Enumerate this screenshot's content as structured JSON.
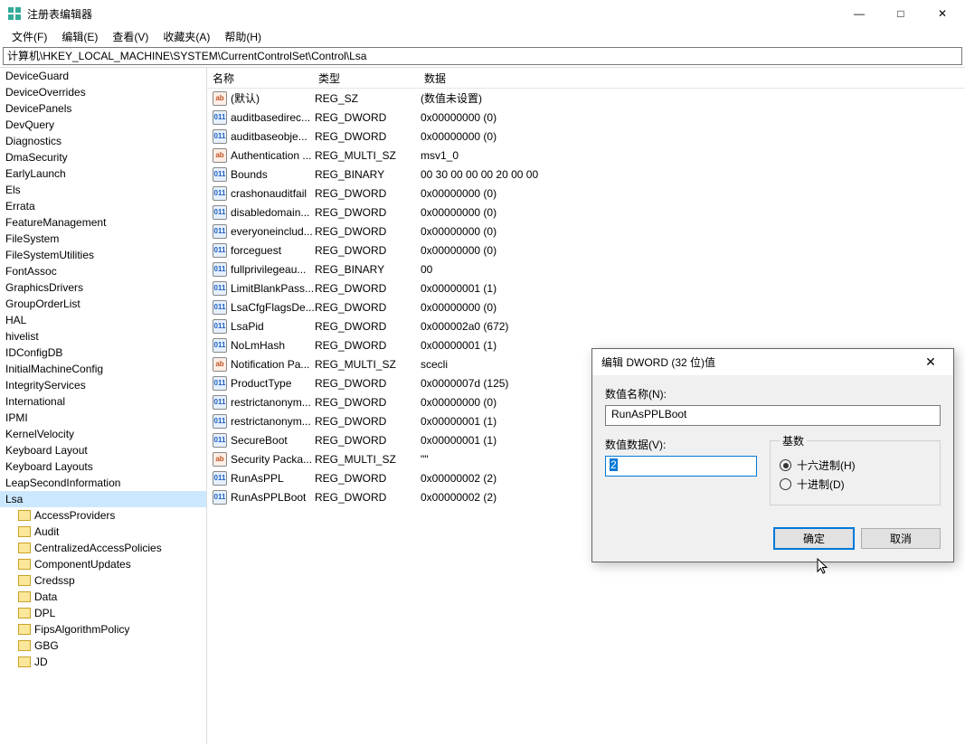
{
  "window": {
    "title": "注册表编辑器",
    "minimize": "—",
    "maximize": "□",
    "close": "✕"
  },
  "menu": {
    "file": "文件(F)",
    "edit": "编辑(E)",
    "view": "查看(V)",
    "favorites": "收藏夹(A)",
    "help": "帮助(H)"
  },
  "address": "计算机\\HKEY_LOCAL_MACHINE\\SYSTEM\\CurrentControlSet\\Control\\Lsa",
  "tree": {
    "items": [
      {
        "label": "DeviceGuard",
        "indent": 0,
        "icon": false
      },
      {
        "label": "DeviceOverrides",
        "indent": 0,
        "icon": false
      },
      {
        "label": "DevicePanels",
        "indent": 0,
        "icon": false
      },
      {
        "label": "DevQuery",
        "indent": 0,
        "icon": false
      },
      {
        "label": "Diagnostics",
        "indent": 0,
        "icon": false
      },
      {
        "label": "DmaSecurity",
        "indent": 0,
        "icon": false
      },
      {
        "label": "EarlyLaunch",
        "indent": 0,
        "icon": false
      },
      {
        "label": "Els",
        "indent": 0,
        "icon": false
      },
      {
        "label": "Errata",
        "indent": 0,
        "icon": false
      },
      {
        "label": "FeatureManagement",
        "indent": 0,
        "icon": false
      },
      {
        "label": "FileSystem",
        "indent": 0,
        "icon": false
      },
      {
        "label": "FileSystemUtilities",
        "indent": 0,
        "icon": false
      },
      {
        "label": "FontAssoc",
        "indent": 0,
        "icon": false
      },
      {
        "label": "GraphicsDrivers",
        "indent": 0,
        "icon": false
      },
      {
        "label": "GroupOrderList",
        "indent": 0,
        "icon": false
      },
      {
        "label": "HAL",
        "indent": 0,
        "icon": false
      },
      {
        "label": "hivelist",
        "indent": 0,
        "icon": false
      },
      {
        "label": "IDConfigDB",
        "indent": 0,
        "icon": false
      },
      {
        "label": "InitialMachineConfig",
        "indent": 0,
        "icon": false
      },
      {
        "label": "IntegrityServices",
        "indent": 0,
        "icon": false
      },
      {
        "label": "International",
        "indent": 0,
        "icon": false
      },
      {
        "label": "IPMI",
        "indent": 0,
        "icon": false
      },
      {
        "label": "KernelVelocity",
        "indent": 0,
        "icon": false
      },
      {
        "label": "Keyboard Layout",
        "indent": 0,
        "icon": false
      },
      {
        "label": "Keyboard Layouts",
        "indent": 0,
        "icon": false
      },
      {
        "label": "LeapSecondInformation",
        "indent": 0,
        "icon": false
      },
      {
        "label": "Lsa",
        "indent": 0,
        "icon": false,
        "selected": true
      },
      {
        "label": "AccessProviders",
        "indent": 1,
        "icon": true
      },
      {
        "label": "Audit",
        "indent": 1,
        "icon": true
      },
      {
        "label": "CentralizedAccessPolicies",
        "indent": 1,
        "icon": true
      },
      {
        "label": "ComponentUpdates",
        "indent": 1,
        "icon": true
      },
      {
        "label": "Credssp",
        "indent": 1,
        "icon": true
      },
      {
        "label": "Data",
        "indent": 1,
        "icon": true
      },
      {
        "label": "DPL",
        "indent": 1,
        "icon": true
      },
      {
        "label": "FipsAlgorithmPolicy",
        "indent": 1,
        "icon": true
      },
      {
        "label": "GBG",
        "indent": 1,
        "icon": true
      },
      {
        "label": "JD",
        "indent": 1,
        "icon": true
      }
    ]
  },
  "columns": {
    "name": "名称",
    "type": "类型",
    "data": "数据"
  },
  "values": [
    {
      "icon": "str",
      "name": "(默认)",
      "type": "REG_SZ",
      "data": "(数值未设置)"
    },
    {
      "icon": "bin",
      "name": "auditbasedirec...",
      "type": "REG_DWORD",
      "data": "0x00000000 (0)"
    },
    {
      "icon": "bin",
      "name": "auditbaseobje...",
      "type": "REG_DWORD",
      "data": "0x00000000 (0)"
    },
    {
      "icon": "str",
      "name": "Authentication ...",
      "type": "REG_MULTI_SZ",
      "data": "msv1_0"
    },
    {
      "icon": "bin",
      "name": "Bounds",
      "type": "REG_BINARY",
      "data": "00 30 00 00 00 20 00 00"
    },
    {
      "icon": "bin",
      "name": "crashonauditfail",
      "type": "REG_DWORD",
      "data": "0x00000000 (0)"
    },
    {
      "icon": "bin",
      "name": "disabledomain...",
      "type": "REG_DWORD",
      "data": "0x00000000 (0)"
    },
    {
      "icon": "bin",
      "name": "everyoneinclud...",
      "type": "REG_DWORD",
      "data": "0x00000000 (0)"
    },
    {
      "icon": "bin",
      "name": "forceguest",
      "type": "REG_DWORD",
      "data": "0x00000000 (0)"
    },
    {
      "icon": "bin",
      "name": "fullprivilegeau...",
      "type": "REG_BINARY",
      "data": "00"
    },
    {
      "icon": "bin",
      "name": "LimitBlankPass...",
      "type": "REG_DWORD",
      "data": "0x00000001 (1)"
    },
    {
      "icon": "bin",
      "name": "LsaCfgFlagsDe...",
      "type": "REG_DWORD",
      "data": "0x00000000 (0)"
    },
    {
      "icon": "bin",
      "name": "LsaPid",
      "type": "REG_DWORD",
      "data": "0x000002a0 (672)"
    },
    {
      "icon": "bin",
      "name": "NoLmHash",
      "type": "REG_DWORD",
      "data": "0x00000001 (1)"
    },
    {
      "icon": "str",
      "name": "Notification Pa...",
      "type": "REG_MULTI_SZ",
      "data": "scecli"
    },
    {
      "icon": "bin",
      "name": "ProductType",
      "type": "REG_DWORD",
      "data": "0x0000007d (125)"
    },
    {
      "icon": "bin",
      "name": "restrictanonym...",
      "type": "REG_DWORD",
      "data": "0x00000000 (0)"
    },
    {
      "icon": "bin",
      "name": "restrictanonym...",
      "type": "REG_DWORD",
      "data": "0x00000001 (1)"
    },
    {
      "icon": "bin",
      "name": "SecureBoot",
      "type": "REG_DWORD",
      "data": "0x00000001 (1)"
    },
    {
      "icon": "str",
      "name": "Security Packa...",
      "type": "REG_MULTI_SZ",
      "data": "\"\""
    },
    {
      "icon": "bin",
      "name": "RunAsPPL",
      "type": "REG_DWORD",
      "data": "0x00000002 (2)"
    },
    {
      "icon": "bin",
      "name": "RunAsPPLBoot",
      "type": "REG_DWORD",
      "data": "0x00000002 (2)"
    }
  ],
  "dialog": {
    "title": "编辑 DWORD (32 位)值",
    "close": "✕",
    "name_label": "数值名称(N):",
    "name_value": "RunAsPPLBoot",
    "data_label": "数值数据(V):",
    "data_value": "2",
    "base_label": "基数",
    "hex_label": "十六进制(H)",
    "dec_label": "十进制(D)",
    "ok": "确定",
    "cancel": "取消"
  },
  "icon_glyphs": {
    "str": "ab",
    "bin": "011"
  }
}
